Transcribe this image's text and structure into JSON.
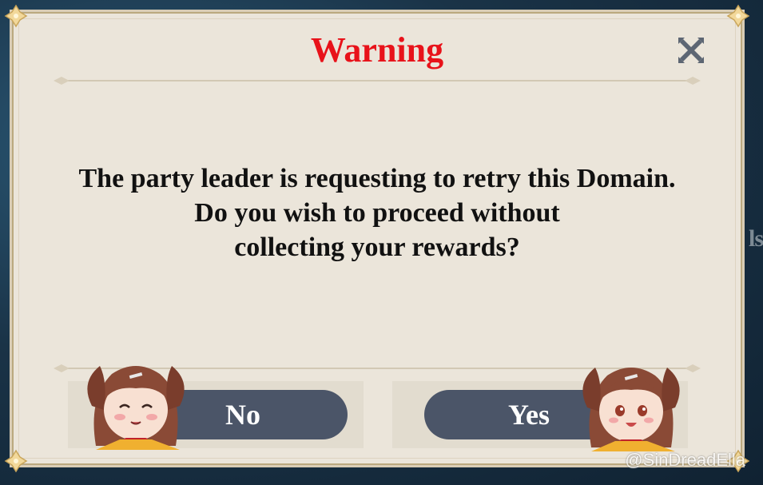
{
  "background": {
    "edge_text": "ls"
  },
  "dialog": {
    "title": "Warning",
    "message_lines": [
      "The party leader is requesting to retry this Domain.",
      "Do you wish to proceed without",
      "collecting your rewards?"
    ],
    "buttons": {
      "no_label": "No",
      "yes_label": "Yes"
    }
  },
  "icons": {
    "close": "close-icon",
    "corner": "corner-ornament-icon"
  },
  "colors": {
    "title": "#e8121a",
    "button": "#4b5568",
    "panel": "#ebe5da"
  },
  "watermark": "@SinDreadElla"
}
